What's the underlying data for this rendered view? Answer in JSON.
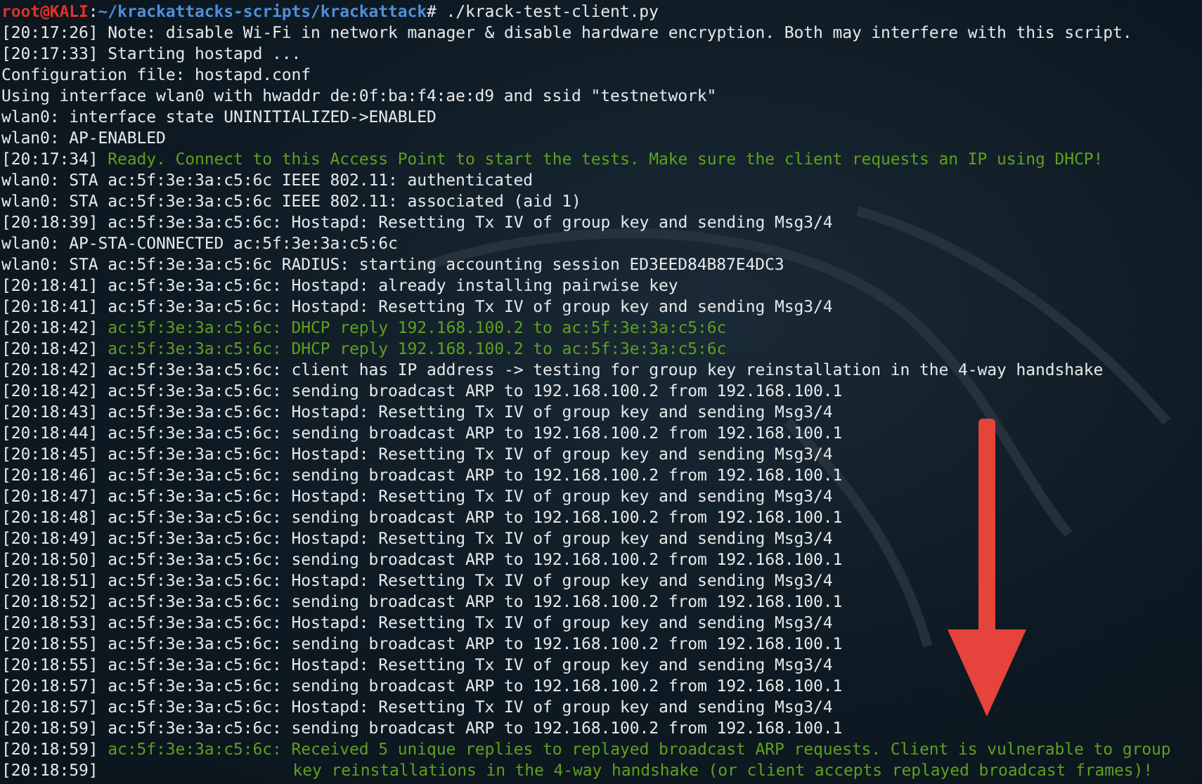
{
  "prompt": {
    "user": "root@KALI",
    "separator": ":",
    "path": "~/krackattacks-scripts/krackattack",
    "symbol": "#",
    "command": "./krack-test-client.py"
  },
  "lines": [
    {
      "kind": "normal",
      "time": "[20:17:26]",
      "text": "Note: disable Wi-Fi in network manager & disable hardware encryption. Both may interfere with this script."
    },
    {
      "kind": "normal",
      "time": "[20:17:33]",
      "text": "Starting hostapd ..."
    },
    {
      "kind": "normal",
      "text": "Configuration file: hostapd.conf"
    },
    {
      "kind": "normal",
      "text": "Using interface wlan0 with hwaddr de:0f:ba:f4:ae:d9 and ssid \"testnetwork\""
    },
    {
      "kind": "normal",
      "text": "wlan0: interface state UNINITIALIZED->ENABLED"
    },
    {
      "kind": "normal",
      "text": "wlan0: AP-ENABLED"
    },
    {
      "kind": "success",
      "time": "[20:17:34]",
      "text": "Ready. Connect to this Access Point to start the tests. Make sure the client requests an IP using DHCP!"
    },
    {
      "kind": "normal",
      "text": "wlan0: STA ac:5f:3e:3a:c5:6c IEEE 802.11: authenticated"
    },
    {
      "kind": "normal",
      "text": "wlan0: STA ac:5f:3e:3a:c5:6c IEEE 802.11: associated (aid 1)"
    },
    {
      "kind": "normal",
      "time": "[20:18:39]",
      "text": "ac:5f:3e:3a:c5:6c: Hostapd: Resetting Tx IV of group key and sending Msg3/4"
    },
    {
      "kind": "normal",
      "text": "wlan0: AP-STA-CONNECTED ac:5f:3e:3a:c5:6c"
    },
    {
      "kind": "normal",
      "text": "wlan0: STA ac:5f:3e:3a:c5:6c RADIUS: starting accounting session ED3EED84B87E4DC3"
    },
    {
      "kind": "normal",
      "time": "[20:18:41]",
      "text": "ac:5f:3e:3a:c5:6c: Hostapd: already installing pairwise key"
    },
    {
      "kind": "normal",
      "time": "[20:18:41]",
      "text": "ac:5f:3e:3a:c5:6c: Hostapd: Resetting Tx IV of group key and sending Msg3/4"
    },
    {
      "kind": "success",
      "time": "[20:18:42]",
      "text": "ac:5f:3e:3a:c5:6c: DHCP reply 192.168.100.2 to ac:5f:3e:3a:c5:6c"
    },
    {
      "kind": "success",
      "time": "[20:18:42]",
      "text": "ac:5f:3e:3a:c5:6c: DHCP reply 192.168.100.2 to ac:5f:3e:3a:c5:6c"
    },
    {
      "kind": "normal",
      "time": "[20:18:42]",
      "text": "ac:5f:3e:3a:c5:6c: client has IP address -> testing for group key reinstallation in the 4-way handshake"
    },
    {
      "kind": "normal",
      "time": "[20:18:42]",
      "text": "ac:5f:3e:3a:c5:6c: sending broadcast ARP to 192.168.100.2 from 192.168.100.1"
    },
    {
      "kind": "normal",
      "time": "[20:18:43]",
      "text": "ac:5f:3e:3a:c5:6c: Hostapd: Resetting Tx IV of group key and sending Msg3/4"
    },
    {
      "kind": "normal",
      "time": "[20:18:44]",
      "text": "ac:5f:3e:3a:c5:6c: sending broadcast ARP to 192.168.100.2 from 192.168.100.1"
    },
    {
      "kind": "normal",
      "time": "[20:18:45]",
      "text": "ac:5f:3e:3a:c5:6c: Hostapd: Resetting Tx IV of group key and sending Msg3/4"
    },
    {
      "kind": "normal",
      "time": "[20:18:46]",
      "text": "ac:5f:3e:3a:c5:6c: sending broadcast ARP to 192.168.100.2 from 192.168.100.1"
    },
    {
      "kind": "normal",
      "time": "[20:18:47]",
      "text": "ac:5f:3e:3a:c5:6c: Hostapd: Resetting Tx IV of group key and sending Msg3/4"
    },
    {
      "kind": "normal",
      "time": "[20:18:48]",
      "text": "ac:5f:3e:3a:c5:6c: sending broadcast ARP to 192.168.100.2 from 192.168.100.1"
    },
    {
      "kind": "normal",
      "time": "[20:18:49]",
      "text": "ac:5f:3e:3a:c5:6c: Hostapd: Resetting Tx IV of group key and sending Msg3/4"
    },
    {
      "kind": "normal",
      "time": "[20:18:50]",
      "text": "ac:5f:3e:3a:c5:6c: sending broadcast ARP to 192.168.100.2 from 192.168.100.1"
    },
    {
      "kind": "normal",
      "time": "[20:18:51]",
      "text": "ac:5f:3e:3a:c5:6c: Hostapd: Resetting Tx IV of group key and sending Msg3/4"
    },
    {
      "kind": "normal",
      "time": "[20:18:52]",
      "text": "ac:5f:3e:3a:c5:6c: sending broadcast ARP to 192.168.100.2 from 192.168.100.1"
    },
    {
      "kind": "normal",
      "time": "[20:18:53]",
      "text": "ac:5f:3e:3a:c5:6c: Hostapd: Resetting Tx IV of group key and sending Msg3/4"
    },
    {
      "kind": "normal",
      "time": "[20:18:55]",
      "text": "ac:5f:3e:3a:c5:6c: sending broadcast ARP to 192.168.100.2 from 192.168.100.1"
    },
    {
      "kind": "normal",
      "time": "[20:18:55]",
      "text": "ac:5f:3e:3a:c5:6c: Hostapd: Resetting Tx IV of group key and sending Msg3/4"
    },
    {
      "kind": "normal",
      "time": "[20:18:57]",
      "text": "ac:5f:3e:3a:c5:6c: sending broadcast ARP to 192.168.100.2 from 192.168.100.1"
    },
    {
      "kind": "normal",
      "time": "[20:18:57]",
      "text": "ac:5f:3e:3a:c5:6c: Hostapd: Resetting Tx IV of group key and sending Msg3/4"
    },
    {
      "kind": "normal",
      "time": "[20:18:59]",
      "text": "ac:5f:3e:3a:c5:6c: sending broadcast ARP to 192.168.100.2 from 192.168.100.1"
    },
    {
      "kind": "success",
      "time": "[20:18:59]",
      "text": "ac:5f:3e:3a:c5:6c: Received 5 unique replies to replayed broadcast ARP requests. Client is vulnerable to group"
    },
    {
      "kind": "continuation",
      "time": "[20:18:59]",
      "text": "key reinstallations in the 4-way handshake (or client accepts replayed broadcast frames)!"
    }
  ]
}
